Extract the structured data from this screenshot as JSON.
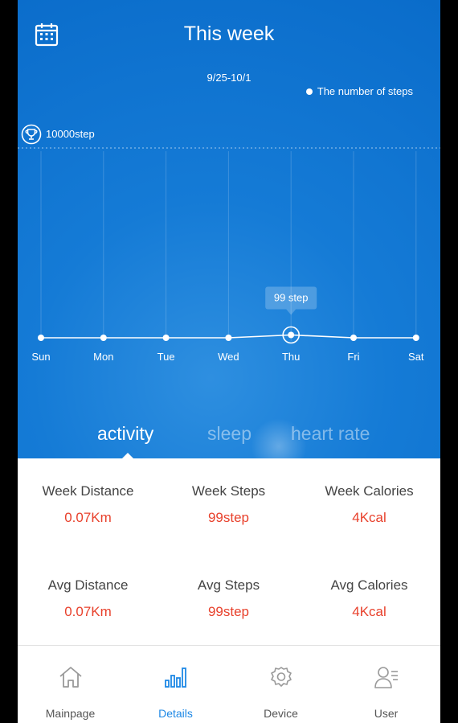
{
  "header": {
    "title": "This week",
    "date_range": "9/25-10/1",
    "legend_label": "The number of steps"
  },
  "goal": {
    "label": "10000step"
  },
  "chart_data": {
    "type": "line",
    "categories": [
      "Sun",
      "Mon",
      "Tue",
      "Wed",
      "Thu",
      "Fri",
      "Sat"
    ],
    "series": [
      {
        "name": "The number of steps",
        "values": [
          0,
          0,
          0,
          0,
          99,
          0,
          0
        ]
      }
    ],
    "goal_value": 10000,
    "selected_index": 4,
    "tooltip": "99 step",
    "grid": true
  },
  "tabs": [
    {
      "label": "activity",
      "active": true
    },
    {
      "label": "sleep",
      "active": false
    },
    {
      "label": "heart rate",
      "active": false
    }
  ],
  "stats": {
    "week_distance": {
      "label": "Week Distance",
      "value": "0.07Km"
    },
    "week_steps": {
      "label": "Week Steps",
      "value": "99step"
    },
    "week_calories": {
      "label": "Week Calories",
      "value": "4Kcal"
    },
    "avg_distance": {
      "label": "Avg Distance",
      "value": "0.07Km"
    },
    "avg_steps": {
      "label": "Avg Steps",
      "value": "99step"
    },
    "avg_calories": {
      "label": "Avg Calories",
      "value": "4Kcal"
    }
  },
  "nav": [
    {
      "label": "Mainpage",
      "icon": "home-icon",
      "active": false
    },
    {
      "label": "Details",
      "icon": "bar-chart-icon",
      "active": true
    },
    {
      "label": "Device",
      "icon": "gear-icon",
      "active": false
    },
    {
      "label": "User",
      "icon": "user-list-icon",
      "active": false
    }
  ],
  "colors": {
    "accent": "#1e88e5",
    "value_red": "#e8412c",
    "hero_blue": "#0f73d0"
  }
}
